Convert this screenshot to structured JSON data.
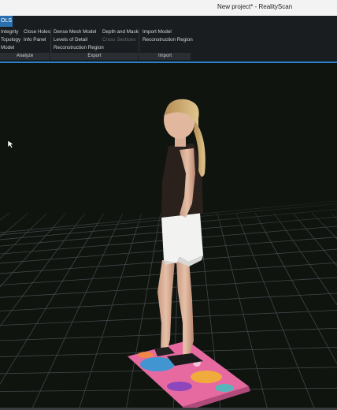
{
  "window": {
    "title": "New project* - RealityScan"
  },
  "ribbon": {
    "active_tab": "OLS",
    "analyze": {
      "group_label": "Analyze",
      "buttons": [
        "Integrity",
        "Topology",
        "Model",
        "Close Holes",
        "Info Panel"
      ]
    },
    "export": {
      "group_label": "Export",
      "buttons": [
        "Dense Mesh Model",
        "Levels of Detail",
        "Reconstruction Region",
        "Depth and Mask",
        "Cross Sections"
      ]
    },
    "import": {
      "group_label": "Import",
      "buttons": [
        "Import Model",
        "Reconstruction Region"
      ]
    }
  },
  "colors": {
    "accent": "#2c7fc8",
    "viewport_bg": "#10140f",
    "grid": "#4a4e52"
  }
}
